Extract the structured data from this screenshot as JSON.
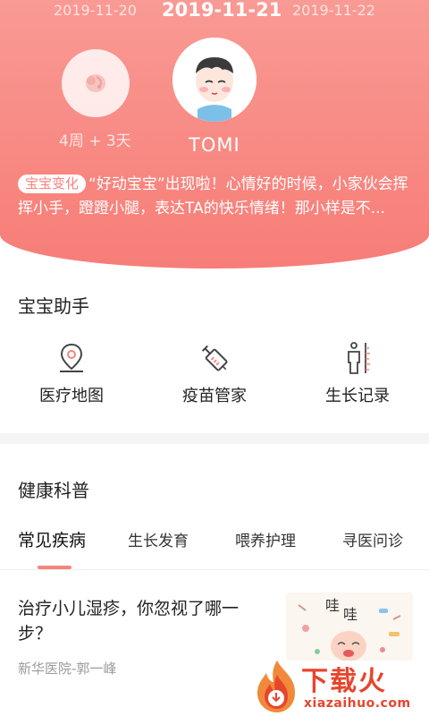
{
  "header": {
    "dates": {
      "prev": "2019-11-20",
      "current": "2019-11-21",
      "next": "2019-11-22"
    },
    "fetus_age": "4周 + 3天",
    "baby_name": "TOMI",
    "change_tag": "宝宝变化",
    "change_text": "“好动宝宝”出现啦！心情好的时候，小家伙会挥挥小手，蹬蹬小腿，表达TA的快乐情绪！那小样是不..."
  },
  "assistant": {
    "title": "宝宝助手",
    "tools": [
      {
        "label": "医疗地图",
        "icon": "map-pin-icon"
      },
      {
        "label": "疫苗管家",
        "icon": "syringe-icon"
      },
      {
        "label": "生长记录",
        "icon": "growth-ruler-icon"
      }
    ]
  },
  "health": {
    "title": "健康科普",
    "tabs": [
      {
        "label": "常见疾病",
        "active": true
      },
      {
        "label": "生长发育",
        "active": false
      },
      {
        "label": "喂养护理",
        "active": false
      },
      {
        "label": "寻医问诊",
        "active": false
      }
    ],
    "article": {
      "title": "治疗小儿湿疹，你忽视了哪一步？",
      "source": "新华医院-郭一峰",
      "thumb_text": "哇哇"
    }
  },
  "watermark": {
    "text": "下载火",
    "url": "xiazaihuo.com"
  },
  "colors": {
    "accent": "#f7837d",
    "header": "#f99a94",
    "watermark": "#e8452d"
  }
}
